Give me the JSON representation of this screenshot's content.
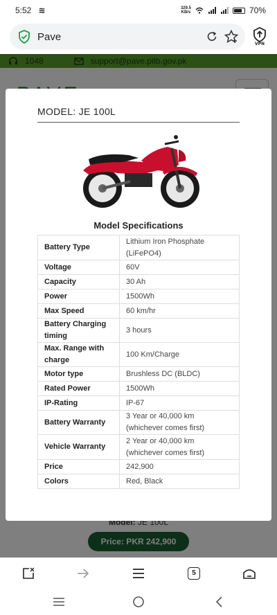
{
  "status_bar": {
    "time": "5:52",
    "glyph": "≋",
    "net_speed_value": "329.5",
    "net_speed_unit": "KB/s",
    "battery": "70%"
  },
  "browser": {
    "url": "Pave",
    "icons": [
      "shield-check-icon",
      "reload-icon",
      "star-icon",
      "vpn-icon"
    ]
  },
  "site": {
    "phone": "1048",
    "email": "support@pave.pitb.gov.pk",
    "logo": "PAVE",
    "model_label": "Model:",
    "model_value": "JE 100L",
    "price_button": "Price: PKR 242,900"
  },
  "modal": {
    "title": "MODEL: JE 100L",
    "specs_title": "Model Specifications",
    "specs": [
      {
        "key": "Battery Type",
        "value": "Lithium Iron Phosphate (LiFePO4)"
      },
      {
        "key": "Voltage",
        "value": "60V"
      },
      {
        "key": "Capacity",
        "value": "30 Ah"
      },
      {
        "key": "Power",
        "value": "1500Wh"
      },
      {
        "key": "Max Speed",
        "value": "60 km/hr"
      },
      {
        "key": "Battery Charging timing",
        "value": "3 hours"
      },
      {
        "key": "Max. Range with charge",
        "value": "100 Km/Charge"
      },
      {
        "key": "Motor type",
        "value": "Brushless DC (BLDC)"
      },
      {
        "key": "Rated Power",
        "value": "1500Wh"
      },
      {
        "key": "IP-Rating",
        "value": "IP-67"
      },
      {
        "key": "Battery Warranty",
        "value": "3 Year or 40,000 km (whichever comes first)"
      },
      {
        "key": "Vehicle Warranty",
        "value": "2 Year or 40,000 km (whichever comes first)"
      },
      {
        "key": "Price",
        "value": "242,900"
      },
      {
        "key": "Colors",
        "value": "Red, Black"
      }
    ]
  },
  "bottom_nav": {
    "tab_count": "5",
    "items": [
      "new-tab-icon",
      "forward-icon",
      "menu-icon",
      "tabs-icon",
      "home-icon"
    ]
  },
  "colors": {
    "brand_green": "#5aa02c",
    "price_button": "#1b5e34",
    "bike_red": "#c8102e"
  }
}
